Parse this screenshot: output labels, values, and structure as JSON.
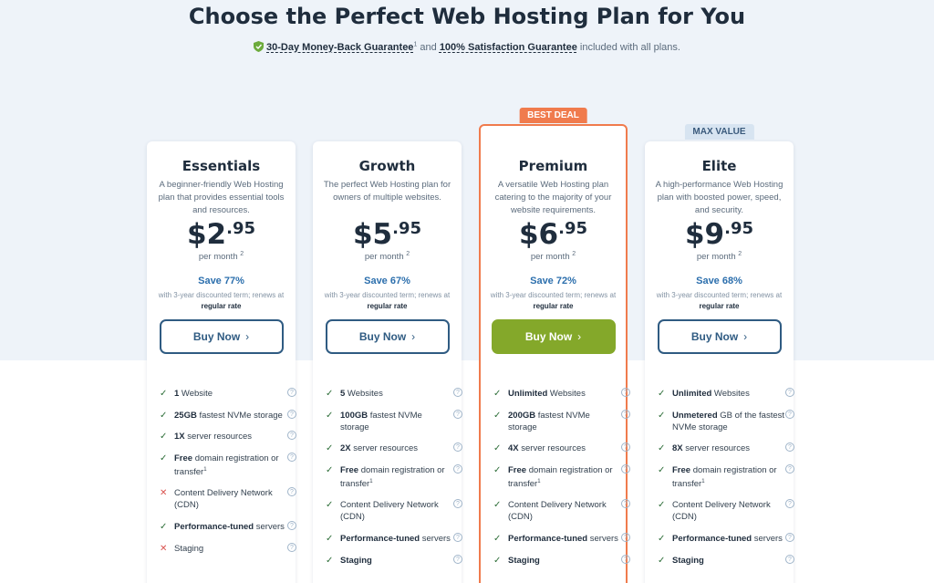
{
  "header": {
    "title": "Choose the Perfect Web Hosting Plan for You",
    "guarantee_1": "30-Day Money-Back Guarantee",
    "guarantee_1_sup": "1",
    "and": " and ",
    "guarantee_2": "100% Satisfaction Guarantee",
    "suffix": " included with all plans."
  },
  "plans": [
    {
      "name": "Essentials",
      "badge": "",
      "desc": "A beginner-friendly Web Hosting plan that provides essential tools and resources.",
      "dollar": "$2",
      "cents": ".95",
      "per": "per month",
      "per_sup": "2",
      "save": "Save 77%",
      "terms_pre": "with 3-year discounted term; renews at ",
      "terms_link": "regular rate",
      "buy": "Buy Now",
      "features": [
        {
          "ok": true,
          "bold": "1",
          "text": " Website",
          "sup": ""
        },
        {
          "ok": true,
          "bold": "25GB",
          "text": " fastest NVMe storage",
          "sup": ""
        },
        {
          "ok": true,
          "bold": "1X",
          "text": " server resources",
          "sup": ""
        },
        {
          "ok": true,
          "bold": "Free",
          "text": " domain registration or transfer",
          "sup": "1"
        },
        {
          "ok": false,
          "bold": "",
          "text": "Content Delivery Network (CDN)",
          "sup": ""
        },
        {
          "ok": true,
          "bold": "Performance-tuned",
          "text": " servers",
          "sup": ""
        },
        {
          "ok": false,
          "bold": "",
          "text": "Staging",
          "sup": ""
        }
      ]
    },
    {
      "name": "Growth",
      "badge": "",
      "desc": "The perfect Web Hosting plan for owners of multiple websites.",
      "dollar": "$5",
      "cents": ".95",
      "per": "per month",
      "per_sup": "2",
      "save": "Save 67%",
      "terms_pre": "with 3-year discounted term; renews at ",
      "terms_link": "regular rate",
      "buy": "Buy Now",
      "features": [
        {
          "ok": true,
          "bold": "5",
          "text": " Websites",
          "sup": ""
        },
        {
          "ok": true,
          "bold": "100GB",
          "text": " fastest NVMe storage",
          "sup": ""
        },
        {
          "ok": true,
          "bold": "2X",
          "text": " server resources",
          "sup": ""
        },
        {
          "ok": true,
          "bold": "Free",
          "text": " domain registration or transfer",
          "sup": "1"
        },
        {
          "ok": true,
          "bold": "",
          "text": "Content Delivery Network (CDN)",
          "sup": ""
        },
        {
          "ok": true,
          "bold": "Performance-tuned",
          "text": " servers",
          "sup": ""
        },
        {
          "ok": true,
          "bold": "Staging",
          "text": "",
          "sup": ""
        }
      ]
    },
    {
      "name": "Premium",
      "badge": "BEST DEAL",
      "desc": "A versatile Web Hosting plan catering to the majority of your website requirements.",
      "dollar": "$6",
      "cents": ".95",
      "per": "per month",
      "per_sup": "2",
      "save": "Save 72%",
      "terms_pre": "with 3-year discounted term; renews at ",
      "terms_link": "regular rate",
      "buy": "Buy Now",
      "features": [
        {
          "ok": true,
          "bold": "Unlimited",
          "text": " Websites",
          "sup": ""
        },
        {
          "ok": true,
          "bold": "200GB",
          "text": " fastest NVMe storage",
          "sup": ""
        },
        {
          "ok": true,
          "bold": "4X",
          "text": " server resources",
          "sup": ""
        },
        {
          "ok": true,
          "bold": "Free",
          "text": " domain registration or transfer",
          "sup": "1"
        },
        {
          "ok": true,
          "bold": "",
          "text": "Content Delivery Network (CDN)",
          "sup": ""
        },
        {
          "ok": true,
          "bold": "Performance-tuned",
          "text": " servers",
          "sup": ""
        },
        {
          "ok": true,
          "bold": "Staging",
          "text": "",
          "sup": ""
        }
      ]
    },
    {
      "name": "Elite",
      "badge": "MAX VALUE",
      "desc": "A high-performance Web Hosting plan with boosted power, speed, and security.",
      "dollar": "$9",
      "cents": ".95",
      "per": "per month",
      "per_sup": "2",
      "save": "Save 68%",
      "terms_pre": "with 3-year discounted term; renews at ",
      "terms_link": "regular rate",
      "buy": "Buy Now",
      "features": [
        {
          "ok": true,
          "bold": "Unlimited",
          "text": " Websites",
          "sup": ""
        },
        {
          "ok": true,
          "bold": "Unmetered",
          "text": " GB of the fastest NVMe storage",
          "sup": ""
        },
        {
          "ok": true,
          "bold": "8X",
          "text": " server resources",
          "sup": ""
        },
        {
          "ok": true,
          "bold": "Free",
          "text": " domain registration or transfer",
          "sup": "1"
        },
        {
          "ok": true,
          "bold": "",
          "text": "Content Delivery Network (CDN)",
          "sup": ""
        },
        {
          "ok": true,
          "bold": "Performance-tuned",
          "text": " servers",
          "sup": ""
        },
        {
          "ok": true,
          "bold": "Staging",
          "text": "",
          "sup": ""
        }
      ]
    }
  ],
  "icons": {
    "check": "check-icon",
    "cross": "cross-icon",
    "help": "help-icon",
    "shield": "shield-check-icon",
    "chevron": "chevron-right-icon"
  },
  "colors": {
    "accent_orange": "#f07b4d",
    "button_green": "#84a82a",
    "button_blue": "#2f5b82",
    "save_blue": "#2c6fad"
  }
}
